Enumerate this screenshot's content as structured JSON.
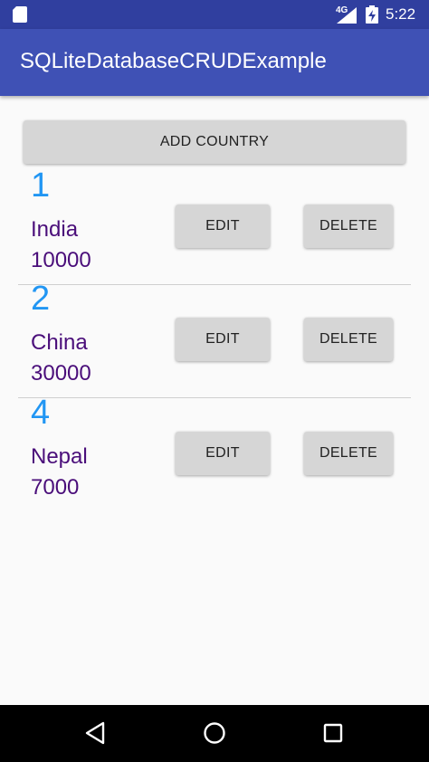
{
  "status": {
    "network": "4G",
    "time": "5:22"
  },
  "app": {
    "title": "SQLiteDatabaseCRUDExample"
  },
  "add_button": "ADD COUNTRY",
  "countries": [
    {
      "id": "1",
      "name": "India",
      "population": "10000",
      "edit": "EDIT",
      "delete": "DELETE"
    },
    {
      "id": "2",
      "name": "China",
      "population": "30000",
      "edit": "EDIT",
      "delete": "DELETE"
    },
    {
      "id": "4",
      "name": "Nepal",
      "population": "7000",
      "edit": "EDIT",
      "delete": "DELETE"
    }
  ],
  "icons": {
    "status": [
      "sd-card-icon",
      "signal-icon",
      "battery-charging-icon"
    ],
    "nav": [
      "back-icon",
      "home-icon",
      "recents-icon"
    ]
  },
  "colors": {
    "status_bar": "#303f9f",
    "app_bar": "#3f51b5",
    "id_text": "#2196f3",
    "country_text": "#4a0e7a"
  }
}
